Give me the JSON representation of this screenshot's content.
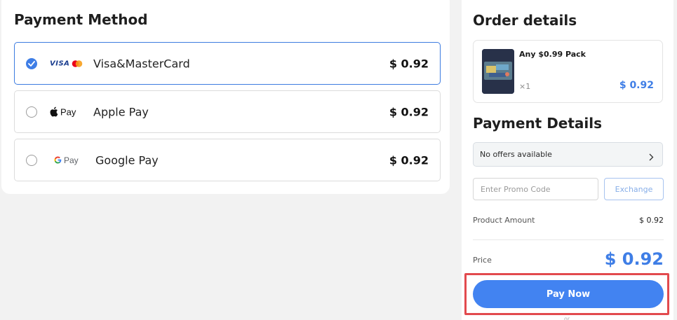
{
  "payment_method": {
    "title": "Payment Method",
    "options": [
      {
        "label": "Visa&MasterCard",
        "price": "$ 0.92",
        "selected": true,
        "icon": "visa-mastercard-icon",
        "logo_text": "VISA"
      },
      {
        "label": "Apple Pay",
        "price": "$ 0.92",
        "selected": false,
        "icon": "apple-pay-icon",
        "logo_text": "Pay"
      },
      {
        "label": "Google Pay",
        "price": "$ 0.92",
        "selected": false,
        "icon": "google-pay-icon",
        "logo_text": "Pay"
      }
    ]
  },
  "order_details": {
    "title": "Order details",
    "product": {
      "name": "Any $0.99 Pack",
      "quantity": "×1",
      "price": "$ 0.92"
    }
  },
  "payment_details": {
    "title": "Payment Details",
    "offers_text": "No offers available",
    "promo_placeholder": "Enter Promo Code",
    "exchange_label": "Exchange",
    "product_amount_label": "Product Amount",
    "product_amount_value": "$ 0.92",
    "price_label": "Price",
    "price_value": "$ 0.92",
    "pay_button_label": "Pay Now",
    "or_text": "or"
  },
  "colors": {
    "accent": "#3f7ee6",
    "pay_button": "#4283f1",
    "highlight": "#e24a4e"
  }
}
